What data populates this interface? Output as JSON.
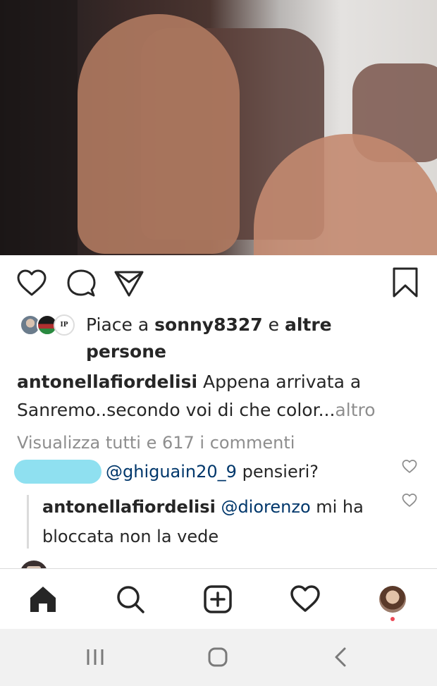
{
  "post": {
    "liked_by_prefix": "Piace a ",
    "liked_by_user": "sonny8327",
    "liked_by_suffix_e": " e ",
    "liked_by_others": "altre persone",
    "avatar_badge": "IP",
    "caption_user": "antonellafiordelisi",
    "caption_text": " Appena arrivata a Sanremo..secondo voi di che color...",
    "caption_more": "altro",
    "view_all_comments": "Visualizza tutti e 617 i commenti"
  },
  "comments": [
    {
      "user": "",
      "mention": "@ghiguain20_9",
      "text": " pensieri?"
    },
    {
      "user": "antonellafiordelisi",
      "mention": "@diorenzo",
      "text": " mi ha bloccata non la vede"
    }
  ],
  "icons": {
    "like": "heart-outline-icon",
    "comment": "speech-bubble-icon",
    "share": "paper-plane-icon",
    "save": "bookmark-icon",
    "nav_home": "home-filled-icon",
    "nav_search": "search-icon",
    "nav_add": "plus-square-icon",
    "nav_activity": "heart-outline-icon",
    "nav_profile": "avatar",
    "sys_recents": "recents-bars-icon",
    "sys_home": "rounded-square-icon",
    "sys_back": "chevron-left-icon"
  },
  "colors": {
    "text": "#262626",
    "muted": "#8e8e8e",
    "mention": "#00376b",
    "notification_dot": "#ed4956",
    "scribble": "#8fe0f0"
  }
}
